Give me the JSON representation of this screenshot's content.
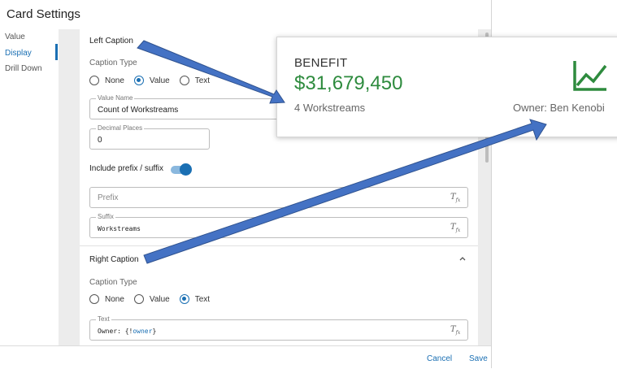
{
  "dialog": {
    "title": "Card Settings"
  },
  "sidebar": {
    "items": [
      {
        "label": "Value"
      },
      {
        "label": "Display"
      },
      {
        "label": "Drill Down"
      }
    ]
  },
  "left_caption": {
    "title": "Left Caption",
    "caption_type_label": "Caption Type",
    "options": [
      "None",
      "Value",
      "Text"
    ],
    "selected": "Value",
    "value_name": {
      "legend": "Value Name",
      "value": "Count of Workstreams"
    },
    "decimal_places": {
      "legend": "Decimal Places",
      "value": "0"
    },
    "include_prefix_suffix": {
      "label": "Include prefix / suffix",
      "on": true
    },
    "prefix": {
      "placeholder": "Prefix"
    },
    "suffix": {
      "legend": "Suffix",
      "value": "Workstreams"
    }
  },
  "right_caption": {
    "title": "Right Caption",
    "caption_type_label": "Caption Type",
    "options": [
      "None",
      "Value",
      "Text"
    ],
    "selected": "Text",
    "text": {
      "legend": "Text",
      "value_prefix": "Owner: {!",
      "value_var": "owner",
      "value_suffix": "}"
    }
  },
  "footer": {
    "cancel": "Cancel",
    "save": "Save"
  },
  "card": {
    "label": "BENEFIT",
    "value": "$31,679,450",
    "left_caption": "4 Workstreams",
    "right_caption": "Owner: Ben Kenobi",
    "accent_color": "#2e8b3e",
    "icon": "trending-up-chart-icon"
  },
  "colors": {
    "accent": "#1a6fb3",
    "arrow_fill": "#4472c4",
    "arrow_stroke": "#2f528f"
  }
}
